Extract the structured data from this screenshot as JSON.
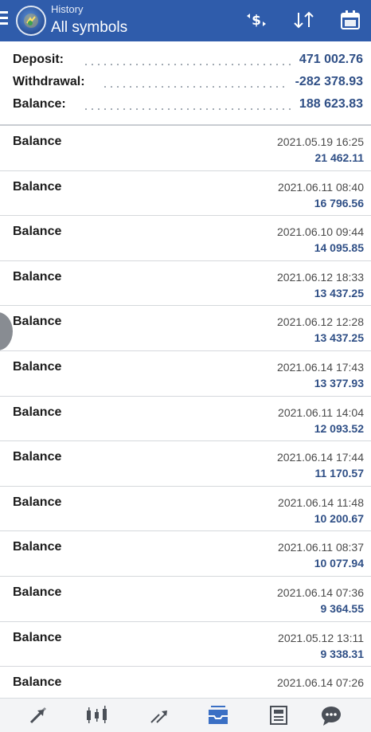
{
  "header": {
    "subtitle": "History",
    "title": "All symbols",
    "icons": [
      "currency-exchange-icon",
      "sort-icon",
      "calendar-icon"
    ]
  },
  "summary": {
    "deposit": {
      "label": "Deposit:",
      "value": "471 002.76"
    },
    "withdrawal": {
      "label": "Withdrawal:",
      "value": "-282 378.93"
    },
    "balance": {
      "label": "Balance:",
      "value": "188 623.83"
    }
  },
  "rows": [
    {
      "label": "Balance",
      "time": "2021.05.19 16:25",
      "amount": "21 462.11"
    },
    {
      "label": "Balance",
      "time": "2021.06.11 08:40",
      "amount": "16 796.56"
    },
    {
      "label": "Balance",
      "time": "2021.06.10 09:44",
      "amount": "14 095.85"
    },
    {
      "label": "Balance",
      "time": "2021.06.12 18:33",
      "amount": "13 437.25"
    },
    {
      "label": "Balance",
      "time": "2021.06.12 12:28",
      "amount": "13 437.25"
    },
    {
      "label": "Balance",
      "time": "2021.06.14 17:43",
      "amount": "13 377.93"
    },
    {
      "label": "Balance",
      "time": "2021.06.11 14:04",
      "amount": "12 093.52"
    },
    {
      "label": "Balance",
      "time": "2021.06.14 17:44",
      "amount": "11 170.57"
    },
    {
      "label": "Balance",
      "time": "2021.06.14 11:48",
      "amount": "10 200.67"
    },
    {
      "label": "Balance",
      "time": "2021.06.11 08:37",
      "amount": "10 077.94"
    },
    {
      "label": "Balance",
      "time": "2021.06.14 07:36",
      "amount": "9 364.55"
    },
    {
      "label": "Balance",
      "time": "2021.05.12 13:11",
      "amount": "9 338.31"
    },
    {
      "label": "Balance",
      "time": "2021.06.14 07:26",
      "amount": ""
    }
  ],
  "bottom_nav": [
    "quotes-icon",
    "chart-icon",
    "trade-icon",
    "history-icon",
    "news-icon",
    "messages-icon"
  ],
  "colors": {
    "header_bg": "#2f5cab",
    "value_blue": "#2f4f86",
    "active_nav": "#3a6fc4"
  }
}
